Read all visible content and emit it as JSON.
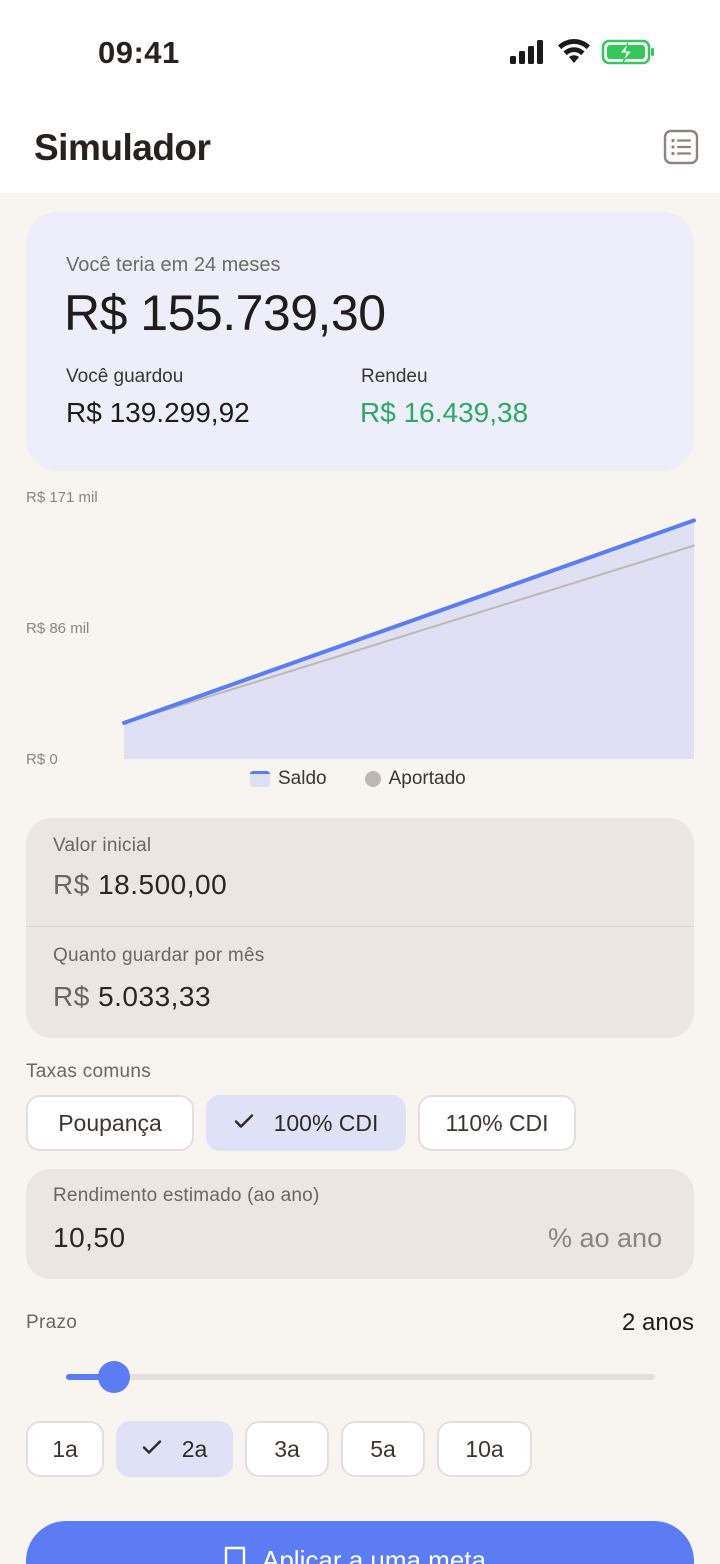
{
  "status_bar": {
    "time": "09:41"
  },
  "header": {
    "title": "Simulador",
    "list_icon": "list-icon"
  },
  "summary": {
    "label": "Você teria em 24 meses",
    "value": "R$ 155.739,30",
    "saved_label": "Você guardou",
    "saved_value": "R$ 139.299,92",
    "earned_label": "Rendeu",
    "earned_value": "R$ 16.439,38"
  },
  "chart_data": {
    "type": "area",
    "x": [
      0,
      24
    ],
    "series": [
      {
        "name": "Saldo",
        "values": [
          23533,
          155739
        ]
      },
      {
        "name": "Aportado",
        "values": [
          23533,
          139300
        ]
      }
    ],
    "y_ticks": [
      "R$ 171 mil",
      "R$ 86 mil",
      "R$ 0"
    ],
    "ylim": [
      0,
      171000
    ],
    "legend": "bottom-center",
    "colors": {
      "Saldo": "#5b7cf2",
      "Aportado": "#bdb8b2",
      "fill": "#dfe0f3"
    }
  },
  "inputs": {
    "initial_label": "Valor inicial",
    "initial_prefix": "R$",
    "initial_value": "18.500,00",
    "monthly_label": "Quanto guardar por mês",
    "monthly_prefix": "R$",
    "monthly_value": "5.033,33"
  },
  "rates": {
    "label": "Taxas comuns",
    "options": [
      "Poupança",
      "100% CDI",
      "110% CDI"
    ],
    "selected": "100% CDI"
  },
  "rate_input": {
    "label": "Rendimento estimado (ao ano)",
    "value": "10,50",
    "suffix": "% ao ano"
  },
  "term": {
    "label": "Prazo",
    "value": "2 anos",
    "slider_fraction": 0.1,
    "options": [
      "1a",
      "2a",
      "3a",
      "5a",
      "10a"
    ],
    "selected": "2a"
  },
  "cta": {
    "label": "Aplicar a uma meta",
    "icon": "bookmark-icon"
  },
  "colors": {
    "accent": "#5b7cf2",
    "positive": "#2ea866",
    "summary_bg": "#eceef9"
  }
}
